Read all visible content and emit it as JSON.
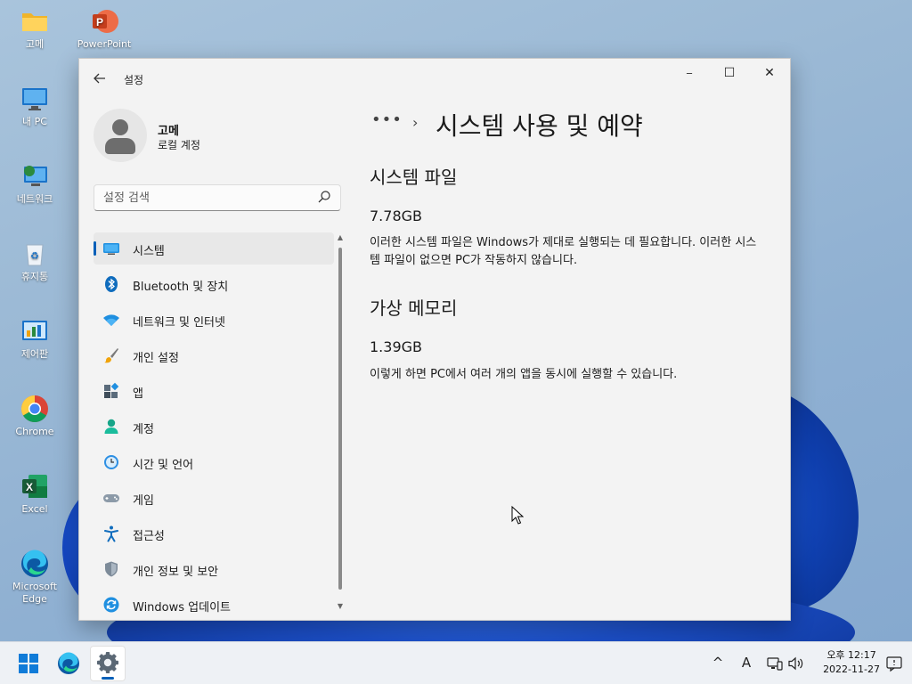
{
  "desktop": {
    "icons": [
      {
        "label": "고메"
      },
      {
        "label": "PowerPoint"
      },
      {
        "label": "내 PC"
      },
      {
        "label": "네트워크"
      },
      {
        "label": "휴지통"
      },
      {
        "label": "제어판"
      },
      {
        "label": "Chrome"
      },
      {
        "label": "Excel"
      },
      {
        "label": "Microsoft Edge"
      }
    ]
  },
  "window": {
    "title": "설정",
    "controls": {
      "minimize": "─",
      "maximize": "☐",
      "close": "✕"
    }
  },
  "account": {
    "name": "고메",
    "type": "로컬 계정"
  },
  "search": {
    "placeholder": "설정 검색"
  },
  "nav": {
    "selected": "시스템",
    "items": [
      {
        "label": "시스템",
        "icon": "monitor-icon"
      },
      {
        "label": "Bluetooth 및 장치",
        "icon": "bluetooth-icon"
      },
      {
        "label": "네트워크 및 인터넷",
        "icon": "wifi-icon"
      },
      {
        "label": "개인 설정",
        "icon": "brush-icon"
      },
      {
        "label": "앱",
        "icon": "apps-icon"
      },
      {
        "label": "계정",
        "icon": "person-icon"
      },
      {
        "label": "시간 및 언어",
        "icon": "clock-globe-icon"
      },
      {
        "label": "게임",
        "icon": "gamepad-icon"
      },
      {
        "label": "접근성",
        "icon": "accessibility-icon"
      },
      {
        "label": "개인 정보 및 보안",
        "icon": "shield-icon"
      },
      {
        "label": "Windows 업데이트",
        "icon": "update-icon"
      }
    ]
  },
  "breadcrumb": {
    "more": "•••",
    "separator": "›",
    "title": "시스템 사용 및 예약"
  },
  "sections": {
    "system_files": {
      "title": "시스템 파일",
      "value": "7.78GB",
      "description": "이러한 시스템 파일은 Windows가 제대로 실행되는 데 필요합니다. 이러한 시스템 파일이 없으면 PC가 작동하지 않습니다."
    },
    "virtual_memory": {
      "title": "가상 메모리",
      "value": "1.39GB",
      "description": "이렇게 하면 PC에서 여러 개의 앱을 동시에 실행할 수 있습니다."
    }
  },
  "taskbar": {
    "buttons": [
      "start-icon",
      "edge-icon",
      "settings-icon"
    ],
    "active": "settings-icon",
    "tray": {
      "chevron": "^",
      "ime": "A"
    },
    "clock": {
      "time": "오후 12:17",
      "date": "2022-11-27"
    }
  },
  "colors": {
    "accent": "#005fb8",
    "window_bg": "#f3f3f3",
    "selected_item_bg": "#e8e8e8"
  }
}
